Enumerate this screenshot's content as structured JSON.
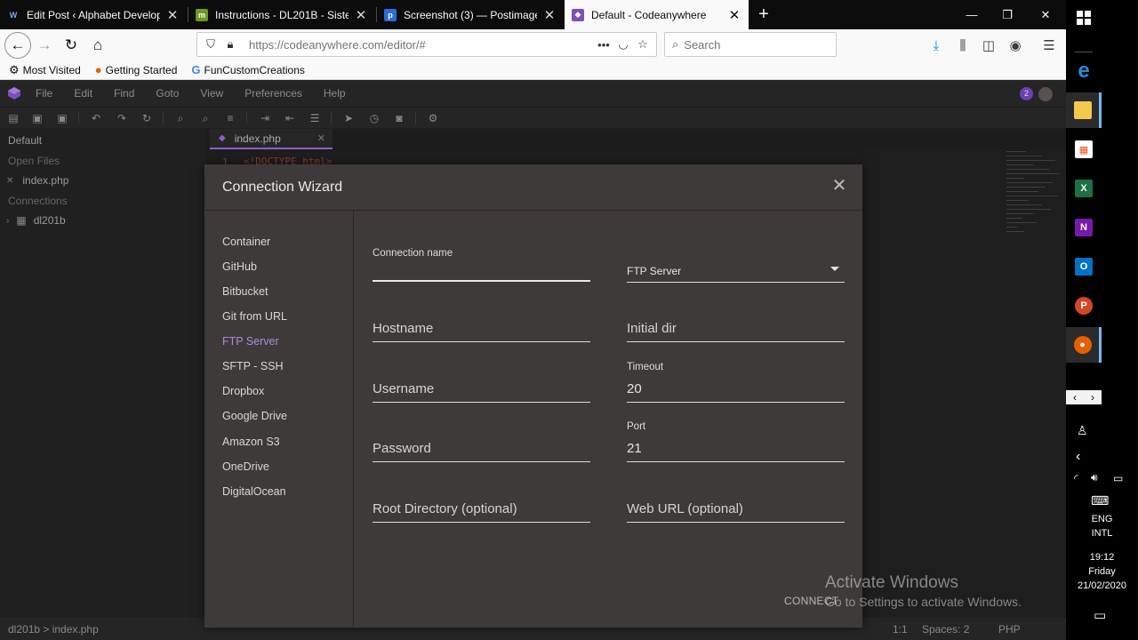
{
  "browser": {
    "tabs": [
      {
        "title": "Edit Post ‹ Alphabet Developme",
        "icon": "wordpress-icon",
        "color": "#1e3a8a"
      },
      {
        "title": "Instructions - DL201B - Sistem I",
        "icon": "moodle-icon",
        "color": "#6c9a1f"
      },
      {
        "title": "Screenshot (3) — Postimage.org",
        "icon": "postimage-icon",
        "color": "#2b6cd8"
      },
      {
        "title": "Default - Codeanywhere",
        "icon": "codeanywhere-icon",
        "color": "#7b4fb8"
      }
    ],
    "url": "https://codeanywhere.com/editor/#",
    "search_placeholder": "Search",
    "bookmarks": [
      "Most Visited",
      "Getting Started",
      "FunCustomCreations"
    ]
  },
  "ide": {
    "menu": [
      "File",
      "Edit",
      "Find",
      "Goto",
      "View",
      "Preferences",
      "Help"
    ],
    "avatar_badge": "2",
    "sidebar": {
      "workspace": "Default",
      "open_files_label": "Open Files",
      "open_file": "index.php",
      "connections_label": "Connections",
      "connection": "dl201b"
    },
    "editor_tab": "index.php",
    "code": {
      "line": "1",
      "text": "<!DOCTYPE html>"
    },
    "status": {
      "path": "dl201b > index.php",
      "cursor": "1:1",
      "spaces": "Spaces: 2",
      "lang": "PHP"
    }
  },
  "wizard": {
    "title": "Connection Wizard",
    "nav": [
      "Container",
      "GitHub",
      "Bitbucket",
      "Git from URL",
      "FTP Server",
      "SFTP - SSH",
      "Dropbox",
      "Google Drive",
      "Amazon S3",
      "OneDrive",
      "DigitalOcean"
    ],
    "active_nav": "FTP Server",
    "fields": {
      "connection_name_label": "Connection name",
      "type_value": "FTP Server",
      "hostname": "Hostname",
      "initial_dir": "Initial dir",
      "username": "Username",
      "timeout_label": "Timeout",
      "timeout_value": "20",
      "password": "Password",
      "port_label": "Port",
      "port_value": "21",
      "root_dir": "Root Directory (optional)",
      "web_url": "Web URL (optional)"
    },
    "connect_label": "CONNECT"
  },
  "watermark": {
    "line1": "Activate Windows",
    "line2": "Go to Settings to activate Windows."
  },
  "taskbar": {
    "lang1": "ENG",
    "lang2": "INTL",
    "time": "19:12",
    "day": "Friday",
    "date": "21/02/2020"
  }
}
